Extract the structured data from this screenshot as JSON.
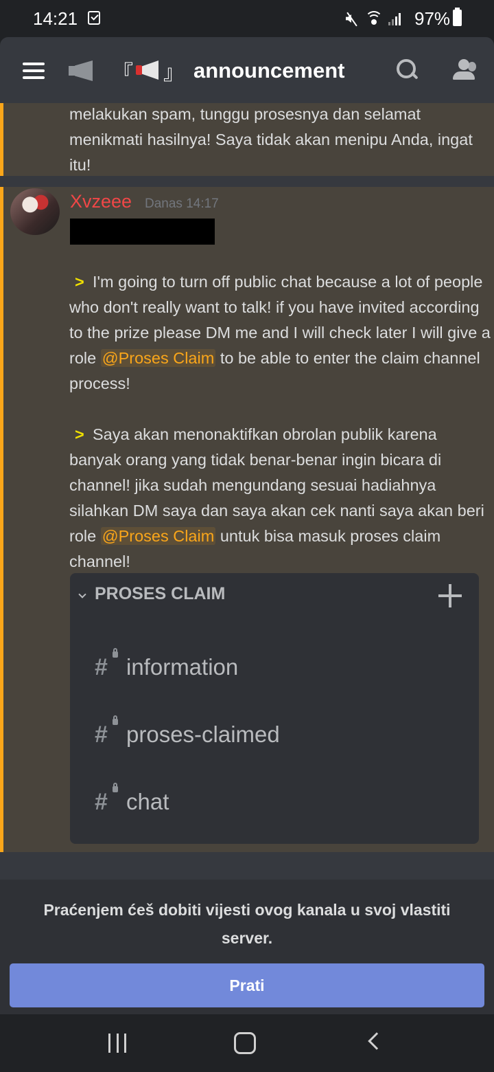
{
  "status_bar": {
    "time": "14:21",
    "battery": "97%"
  },
  "header": {
    "bracket_open": "『",
    "bracket_close": "』",
    "channel_name": "announcement"
  },
  "messages": {
    "previous": {
      "text": "melakukan spam, tunggu prosesnya dan selamat menikmati hasilnya! Saya tidak akan menipu Anda, ingat itu!"
    },
    "main": {
      "author": "Xvzeee",
      "timestamp": "Danas 14:17",
      "arrow": ">",
      "para1_before": "I'm going to turn off public chat because a lot of people who don't really want to talk! if you have invited according to the prize please DM me and I will check later I will give a role ",
      "mention": "@Proses Claim",
      "para1_after": "to be able to enter the claim channel process!",
      "para2_before": "Saya akan menonaktifkan obrolan publik karena banyak orang yang tidak benar-benar ingin bicara di channel! jika sudah mengundang sesuai hadiahnya silahkan DM saya dan saya akan cek nanti saya akan beri role ",
      "para2_after": "untuk bisa masuk proses claim channel!"
    }
  },
  "embed": {
    "category": "PROSES CLAIM",
    "channels": [
      {
        "name": "information"
      },
      {
        "name": "proses-claimed"
      },
      {
        "name": "chat"
      }
    ]
  },
  "follow_panel": {
    "text": "Praćenjem ćeš dobiti vijesti ovog kanala u svoj vlastiti server.",
    "button_label": "Prati"
  },
  "colors": {
    "accent": "#7289da",
    "mention": "#faa61a",
    "username": "#f04747",
    "highlight_bar": "#faa61a"
  }
}
